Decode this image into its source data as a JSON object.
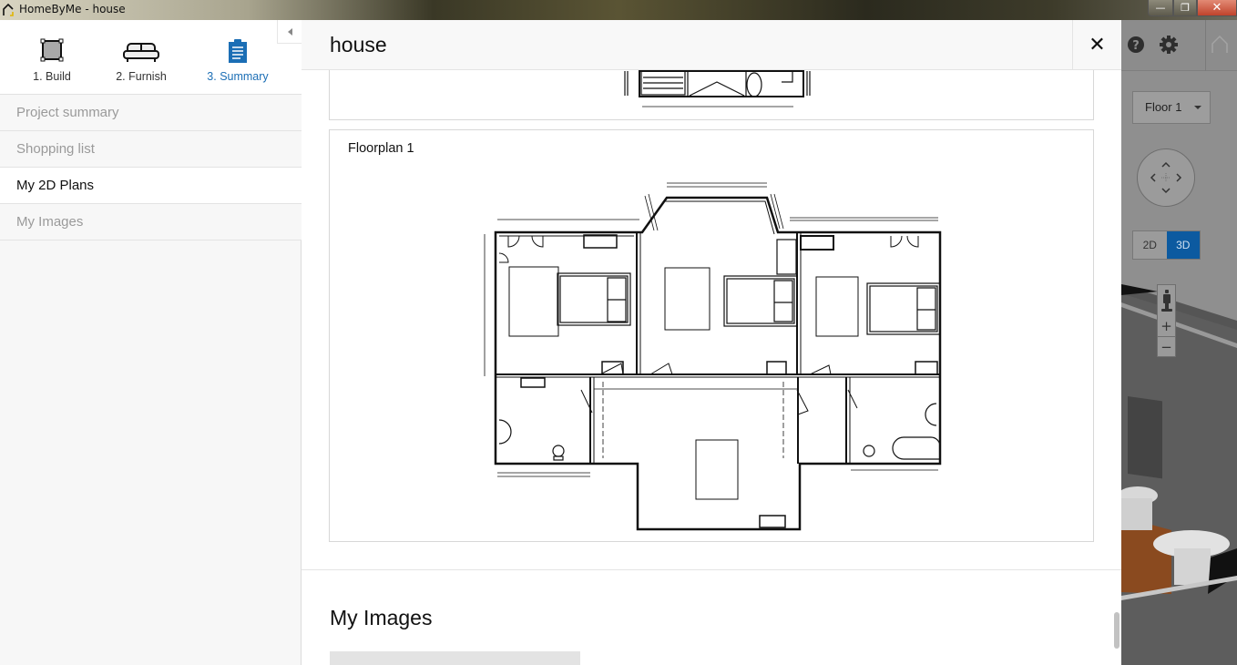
{
  "window": {
    "title": "HomeByMe - house",
    "minimize_label": "—",
    "maximize_label": "❐",
    "close_label": "✕"
  },
  "sidebar": {
    "steps": [
      {
        "label": "1. Build",
        "icon": "build-square-icon",
        "active": false
      },
      {
        "label": "2. Furnish",
        "icon": "sofa-icon",
        "active": false
      },
      {
        "label": "3. Summary",
        "icon": "clipboard-icon",
        "active": true
      }
    ],
    "nav_items": [
      {
        "label": "Project summary",
        "active": false
      },
      {
        "label": "Shopping list",
        "active": false
      },
      {
        "label": "My 2D Plans",
        "active": true
      },
      {
        "label": "My Images",
        "active": false
      }
    ]
  },
  "main": {
    "title": "house",
    "close_label": "✕",
    "plans": [
      {
        "title": ""
      },
      {
        "title": "Floorplan 1"
      }
    ],
    "images_section_title": "My Images"
  },
  "view3d": {
    "floor_select": "Floor 1",
    "toggle_2d": "2D",
    "toggle_3d": "3D",
    "active_view": "3D",
    "zoom_in": "+",
    "zoom_out": "−"
  },
  "colors": {
    "accent": "#1b6eb5",
    "toggle_active": "#0c5aa0",
    "close_button": "#c0432b"
  }
}
